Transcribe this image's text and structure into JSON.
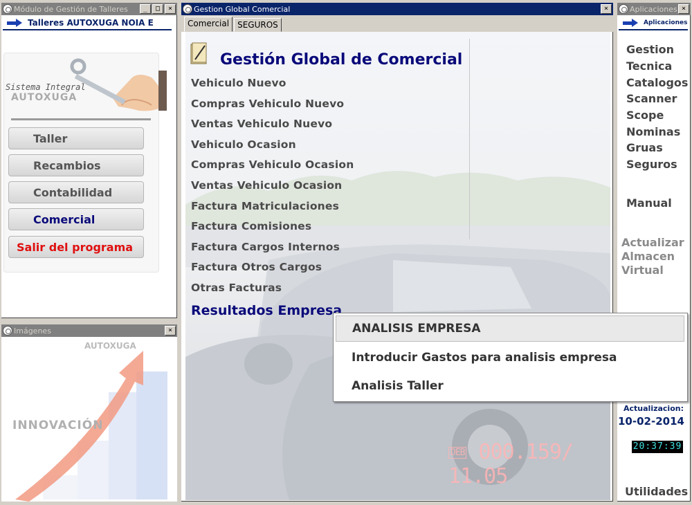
{
  "left_window": {
    "title": "Módulo de Gestión de Talleres",
    "nav": "Talleres AUTOXUGA NOIA E",
    "logo_line1": "Sistema Integral",
    "logo_line2": "AUTOXUGA",
    "buttons": [
      {
        "label": "Taller",
        "color": "#555555"
      },
      {
        "label": "Recambios",
        "color": "#555555"
      },
      {
        "label": "Contabilidad",
        "color": "#555555"
      },
      {
        "label": "Comercial",
        "color": "#0a0a7a"
      },
      {
        "label": "Salir del programa",
        "color": "#e01010"
      }
    ]
  },
  "images_window": {
    "title": "Imágenes",
    "brand": "AUTOXUGA",
    "slogan": "INNOVACIÓN"
  },
  "center_window": {
    "title": "Gestion Global Comercial",
    "tabs": [
      "Comercial",
      "SEGUROS"
    ],
    "heading": "Gestión Global de Comercial",
    "menu": [
      "Vehiculo Nuevo",
      "Compras Vehiculo Nuevo",
      "Ventas Vehiculo Nuevo",
      "Vehiculo Ocasion",
      "Compras Vehiculo Ocasion",
      "Ventas Vehiculo Ocasion",
      "Factura Matriculaciones",
      "Factura Comisiones",
      "Factura Cargos Internos",
      "Factura Otros Cargos",
      "Otras Facturas"
    ],
    "results": "Resultados Empresa",
    "odometer": "000.159/ 11.05",
    "odo_icon": "DEB"
  },
  "popup": {
    "items": [
      "ANALISIS EMPRESA",
      "Introducir Gastos para analisis empresa",
      "Analisis Taller"
    ]
  },
  "right_window": {
    "title": "Aplicaciones",
    "nav": "Aplicaciones",
    "items": [
      "Gestion",
      "Tecnica",
      "Catalogos",
      "Scanner",
      "Scope",
      "Nominas",
      "Gruas",
      "Seguros"
    ],
    "manual": "Manual",
    "update_lines": [
      "Actualizar",
      "Almacen",
      "Virtual"
    ],
    "update_label": "Actualizacion:",
    "update_date": "10-02-2014",
    "clock": "20:37:39",
    "utilities": "Utilidades"
  },
  "icons": {
    "title_icon": "app-icon",
    "nav_arrow": "arrow-right-icon",
    "close": "close-icon",
    "minimize": "minimize-icon",
    "maximize": "maximize-icon",
    "notebook": "notebook-icon",
    "wrench": "wrench-icon"
  }
}
